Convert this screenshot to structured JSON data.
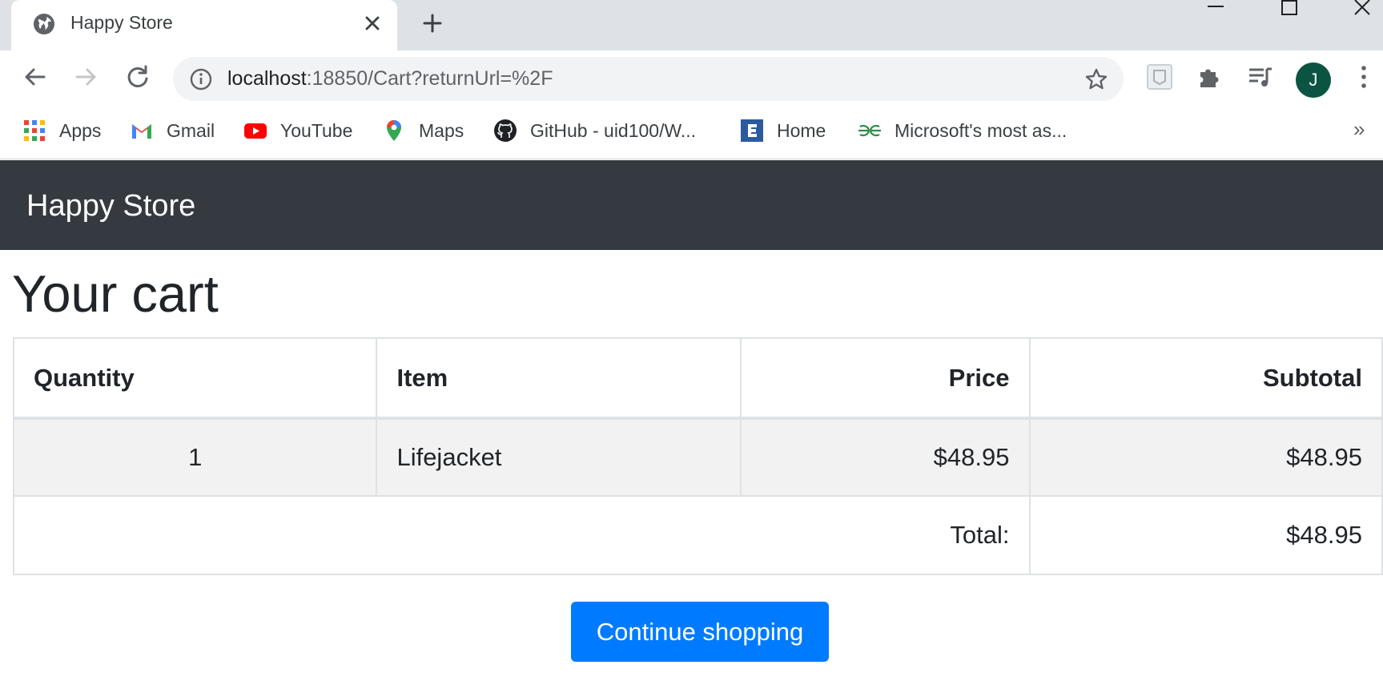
{
  "browser": {
    "tab_title": "Happy Store",
    "url_host": "localhost",
    "url_rest": ":18850/Cart?returnUrl=%2F",
    "avatar_letter": "J",
    "bookmarks": [
      {
        "label": "Apps",
        "icon": "apps-grid-icon"
      },
      {
        "label": "Gmail",
        "icon": "gmail-icon"
      },
      {
        "label": "YouTube",
        "icon": "youtube-icon"
      },
      {
        "label": "Maps",
        "icon": "maps-pin-icon"
      },
      {
        "label": "GitHub - uid100/W...",
        "icon": "github-icon"
      },
      {
        "label": "Home",
        "icon": "e-logo-icon"
      },
      {
        "label": "Microsoft's most as...",
        "icon": "geeksforgeeks-icon"
      }
    ],
    "more_bookmarks": "»"
  },
  "navbar": {
    "brand": "Happy Store"
  },
  "page": {
    "title": "Your cart"
  },
  "cart": {
    "headers": {
      "quantity": "Quantity",
      "item": "Item",
      "price": "Price",
      "subtotal": "Subtotal"
    },
    "rows": [
      {
        "quantity": "1",
        "item": "Lifejacket",
        "price": "$48.95",
        "subtotal": "$48.95"
      }
    ],
    "total_label": "Total:",
    "total_value": "$48.95"
  },
  "actions": {
    "continue_label": "Continue shopping"
  },
  "colors": {
    "navbar": "#343a40",
    "primary": "#007bff",
    "avatar": "#0b5444"
  }
}
